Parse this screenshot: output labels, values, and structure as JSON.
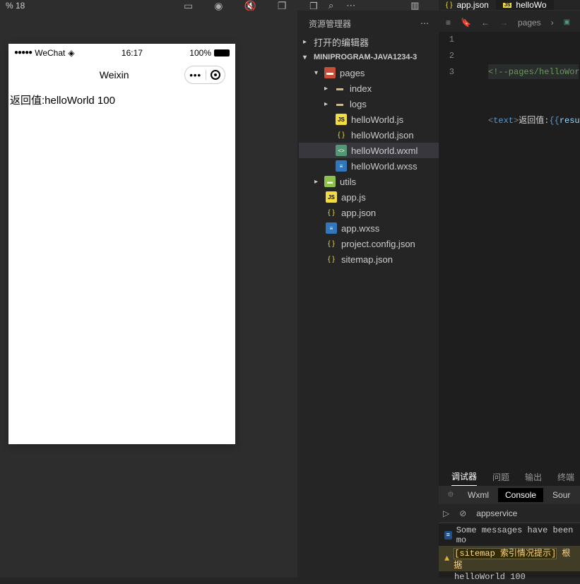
{
  "topbar": {
    "label": "% 18",
    "tab1": "app.json",
    "tab2": "helloWo"
  },
  "explorer": {
    "title": "资源管理器",
    "openEditors": "打开的编辑器",
    "project": "MINIPROGRAM-JAVA1234-3",
    "pages": "pages",
    "index": "index",
    "logs": "logs",
    "hjs": "helloWorld.js",
    "hjson": "helloWorld.json",
    "hwxml": "helloWorld.wxml",
    "hwxss": "helloWorld.wxss",
    "utils": "utils",
    "appjs": "app.js",
    "appjson": "app.json",
    "appwxss": "app.wxss",
    "projconf": "project.config.json",
    "sitemap": "sitemap.json"
  },
  "breadcrumb": {
    "pages": "pages"
  },
  "editor": {
    "line1_comment": "<!--pages/helloWorl",
    "line2_tagOpen": "<",
    "line2_tagName": "text",
    "line2_tagClose": ">",
    "line2_text": "返回值:",
    "line2_exprOpen": "{{",
    "line2_var": "resul"
  },
  "sim": {
    "carrier": "WeChat",
    "time": "16:17",
    "battery": "100%",
    "title": "Weixin",
    "content": "返回值:helloWorld 100"
  },
  "panel": {
    "debugger": "调试器",
    "problems": "问题",
    "output": "输出",
    "terminal": "终端",
    "wxml": "Wxml",
    "console": "Console",
    "sources": "Sour",
    "context": "appservice",
    "msg_info": "Some messages have been mo",
    "msg_warn_tag": "[sitemap 索引情况提示]",
    "msg_warn_tail": "根据",
    "msg_log": "helloWorld 100"
  }
}
